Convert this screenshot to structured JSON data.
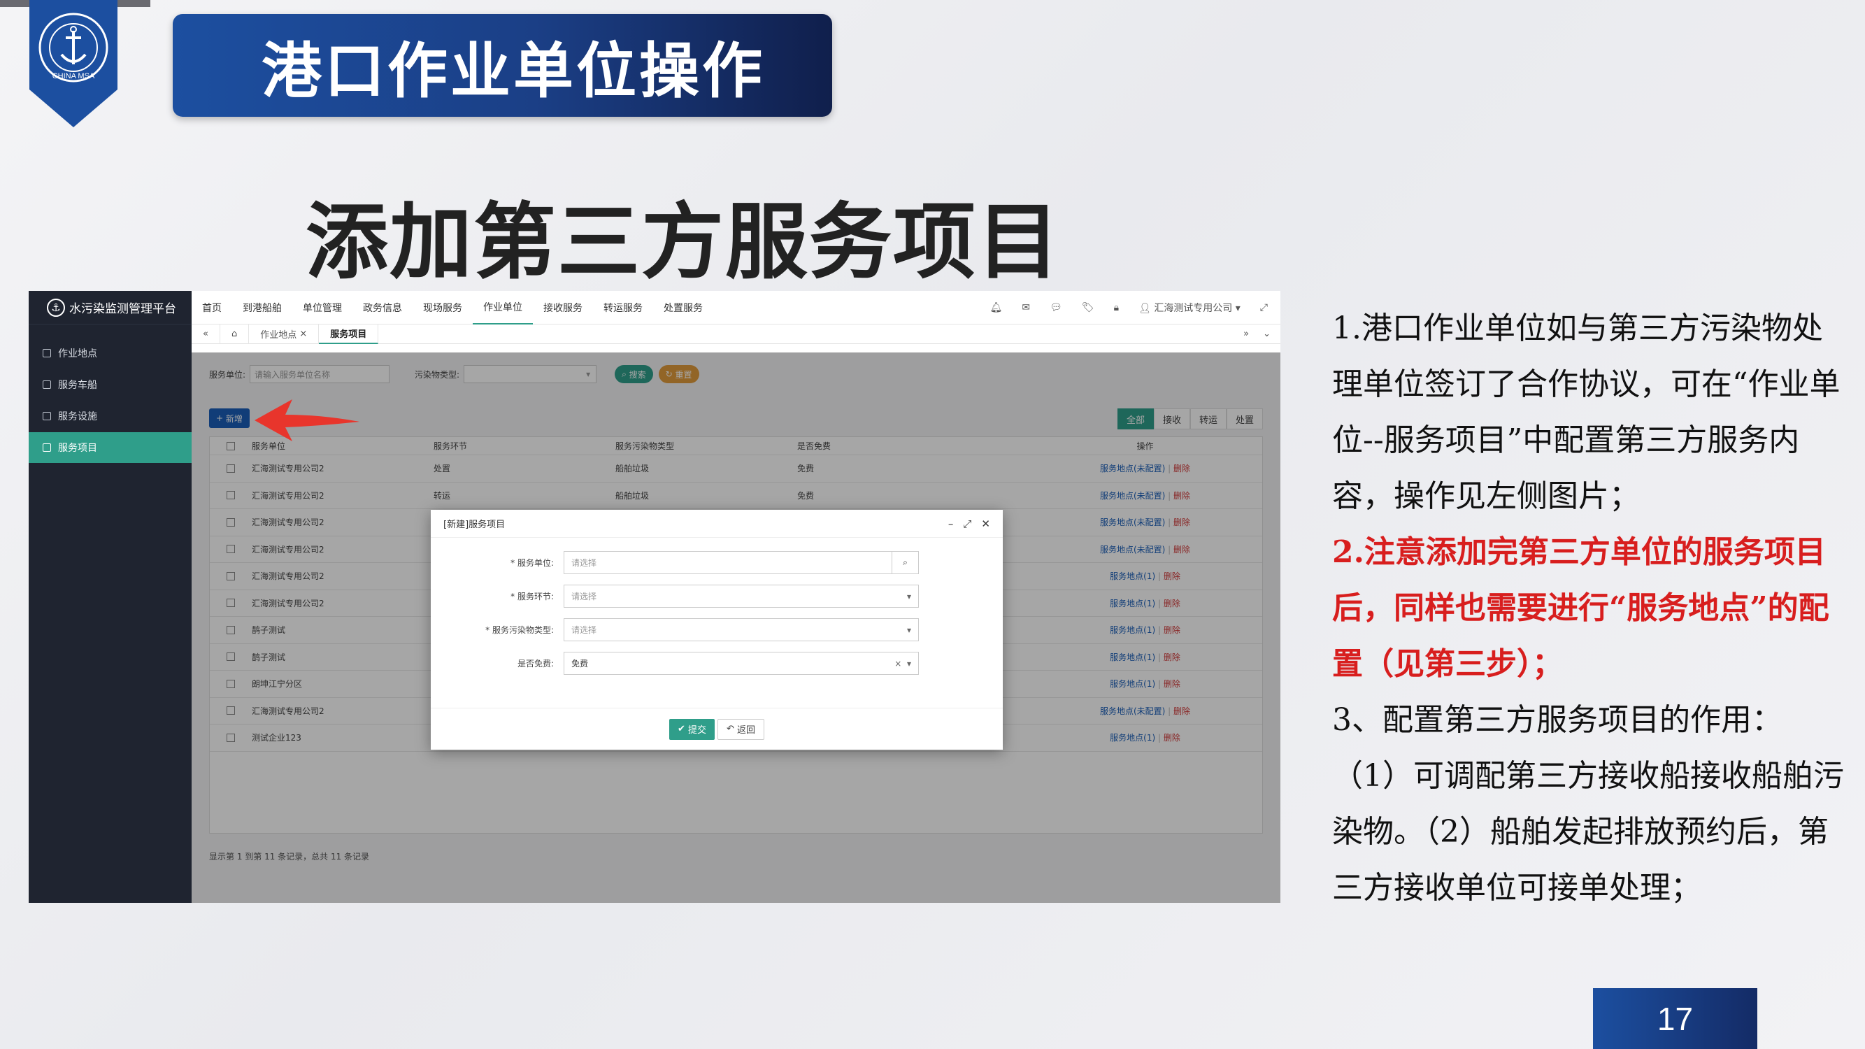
{
  "slide": {
    "title": "港口作业单位操作",
    "subtitle": "添加第三方服务项目",
    "page_number": "17",
    "logo_text": "CHINA MSA"
  },
  "app": {
    "platform_name": "水污染监测管理平台",
    "top_nav": [
      "首页",
      "到港船舶",
      "单位管理",
      "政务信息",
      "现场服务",
      "作业单位",
      "接收服务",
      "转运服务",
      "处置服务"
    ],
    "active_nav": "作业单位",
    "user": "汇海测试专用公司",
    "sidebar": [
      "作业地点",
      "服务车船",
      "服务设施",
      "服务项目"
    ],
    "active_sidebar": "服务项目",
    "tabs": [
      "作业地点",
      "服务项目"
    ],
    "filter": {
      "unit_label": "服务单位:",
      "unit_placeholder": "请输入服务单位名称",
      "type_label": "污染物类型:",
      "search": "搜索",
      "reset": "重置"
    },
    "add_button": "新增",
    "toggle": [
      "全部",
      "接收",
      "转运",
      "处置"
    ],
    "table": {
      "headers": [
        "服务单位",
        "服务环节",
        "服务污染物类型",
        "是否免费",
        "操作"
      ],
      "rows": [
        [
          "汇海测试专用公司2",
          "处置",
          "船舶垃圾",
          "免费",
          "服务地点(未配置)",
          "删除"
        ],
        [
          "汇海测试专用公司2",
          "转运",
          "船舶垃圾",
          "免费",
          "服务地点(未配置)",
          "删除"
        ],
        [
          "汇海测试专用公司2",
          "",
          "",
          "",
          "服务地点(未配置)",
          "删除"
        ],
        [
          "汇海测试专用公司2",
          "",
          "",
          "",
          "服务地点(未配置)",
          "删除"
        ],
        [
          "汇海测试专用公司2",
          "",
          "",
          "",
          "服务地点(1)",
          "删除"
        ],
        [
          "汇海测试专用公司2",
          "",
          "",
          "",
          "服务地点(1)",
          "删除"
        ],
        [
          "鹊子测试",
          "",
          "",
          "",
          "服务地点(1)",
          "删除"
        ],
        [
          "鹊子测试",
          "",
          "",
          "",
          "服务地点(1)",
          "删除"
        ],
        [
          "朗坤江宁分区",
          "",
          "",
          "",
          "服务地点(1)",
          "删除"
        ],
        [
          "汇海测试专用公司2",
          "",
          "",
          "",
          "服务地点(未配置)",
          "删除"
        ],
        [
          "测试企业123",
          "",
          "",
          "",
          "服务地点(1)",
          "删除"
        ]
      ]
    },
    "pager_text": "显示第 1 到第 11 条记录，总共 11 条记录",
    "modal": {
      "title": "[新建]服务项目",
      "fields": [
        {
          "label": "* 服务单位:",
          "value": "请选择",
          "placeholder": true
        },
        {
          "label": "* 服务环节:",
          "value": "请选择",
          "placeholder": true
        },
        {
          "label": "* 服务污染物类型:",
          "value": "请选择",
          "placeholder": true
        },
        {
          "label": "是否免费:",
          "value": "免费",
          "placeholder": false
        }
      ],
      "submit": "提交",
      "back": "返回"
    }
  },
  "notes": {
    "p1": "1.港口作业单位如与第三方污染物处理单位签订了合作协议，可在“作业单位--服务项目”中配置第三方服务内容，操作见左侧图片；",
    "p2": "2.注意添加完第三方单位的服务项目后，同样也需要进行“服务地点”的配置（见第三步）；",
    "p3": "3、配置第三方服务项目的作用：",
    "p4": "（1）可调配第三方接收船接收船舶污染物。（2）船舶发起排放预约后，第三方接收单位可接单处理；"
  },
  "colors": {
    "banner": "#1c4fa0",
    "accent": "#2f9e8a",
    "highlight": "#d81e1e"
  }
}
